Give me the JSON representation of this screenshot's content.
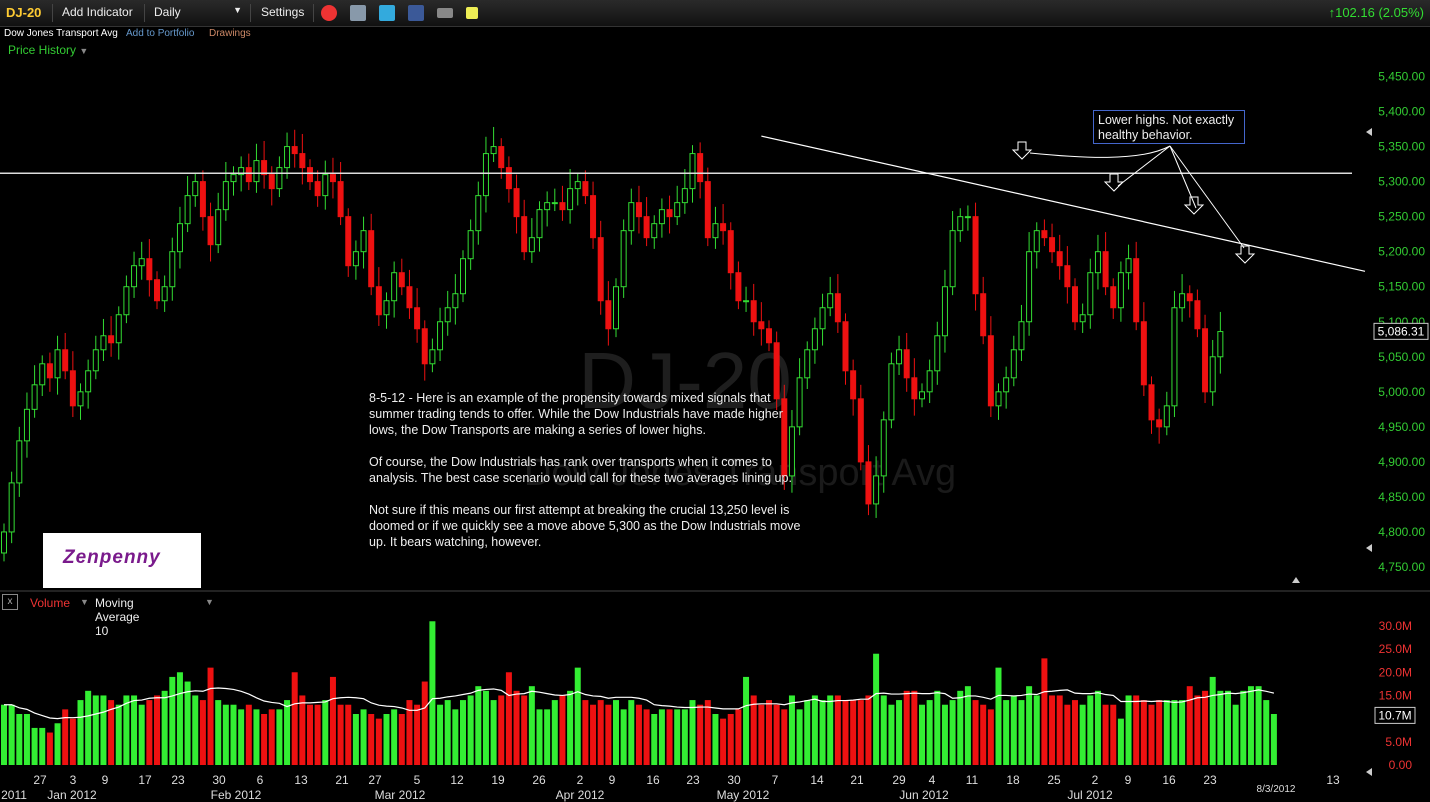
{
  "toolbar": {
    "symbol": "DJ-20",
    "add_indicator": "Add Indicator",
    "interval": "Daily",
    "settings": "Settings",
    "change": "102.16 (2.05%)",
    "change_color": "#33dd33"
  },
  "subbar": {
    "name": "Dow Jones Transport Avg",
    "add_to_portfolio": "Add to Portfolio",
    "drawings": "Drawings"
  },
  "price_history_label": "Price History",
  "watermark": {
    "symbol": "DJ-20",
    "name": "Dow Jones Transport Avg"
  },
  "note": {
    "p1": "8-5-12 - Here is an example of the propensity towards mixed signals that summer trading tends to offer. While the Dow Industrials have made higher lows, the Dow Transports are making a series of lower highs.",
    "p2": "Of course, the Dow Industrials has rank over transports when it comes to analysis. The best case scenario would call for these two averages lining up.",
    "p3": "Not sure if this means our first attempt at breaking the crucial 13,250 level is doomed or if we quickly see a move above 5,300 as the Dow Industrials move up. It bears watching, however."
  },
  "callout": "Lower highs. Not exactly healthy behavior.",
  "logo_text": "Zenpenny",
  "volume_panel": {
    "close_glyph": "x",
    "label": "Volume",
    "ma_label": "Moving Average 10",
    "current": "10.7M"
  },
  "x_axis_date_label": "8/3/2012",
  "chart_data": [
    {
      "type": "candlestick",
      "title": "",
      "y_ticks": [
        "4,750.00",
        "4,800.00",
        "4,850.00",
        "4,900.00",
        "4,950.00",
        "5,000.00",
        "5,050.00",
        "5,100.00",
        "5,150.00",
        "5,200.00",
        "5,250.00",
        "5,300.00",
        "5,350.00",
        "5,400.00",
        "5,450.00"
      ],
      "ylim": [
        4720,
        5485
      ],
      "last_price": "5,086.31",
      "horizontal_line": 5312,
      "trendline": [
        [
          5365,
          5172
        ]
      ],
      "x_day_labels": [
        "27",
        "3",
        "9",
        "17",
        "23",
        "30",
        "6",
        "13",
        "21",
        "27",
        "5",
        "12",
        "19",
        "26",
        "2",
        "9",
        "16",
        "23",
        "30",
        "7",
        "14",
        "21",
        "29",
        "4",
        "11",
        "18",
        "25",
        "2",
        "9",
        "16",
        "23",
        "13"
      ],
      "x_month_labels": [
        "2011",
        "Jan 2012",
        "Feb 2012",
        "Mar 2012",
        "Apr 2012",
        "May 2012",
        "Jun 2012",
        "Jul 2012"
      ],
      "closes": [
        4800,
        4870,
        4930,
        4975,
        5010,
        5040,
        5020,
        5060,
        5030,
        4980,
        5000,
        5030,
        5060,
        5080,
        5070,
        5110,
        5150,
        5180,
        5190,
        5160,
        5130,
        5150,
        5200,
        5240,
        5280,
        5300,
        5250,
        5210,
        5260,
        5300,
        5310,
        5320,
        5300,
        5330,
        5310,
        5290,
        5320,
        5350,
        5340,
        5320,
        5300,
        5280,
        5310,
        5300,
        5250,
        5180,
        5200,
        5230,
        5150,
        5110,
        5130,
        5170,
        5150,
        5120,
        5090,
        5040,
        5060,
        5100,
        5120,
        5140,
        5190,
        5230,
        5280,
        5340,
        5350,
        5320,
        5290,
        5250,
        5200,
        5220,
        5260,
        5270,
        5270,
        5260,
        5290,
        5300,
        5280,
        5220,
        5130,
        5090,
        5150,
        5230,
        5270,
        5250,
        5220,
        5240,
        5260,
        5250,
        5270,
        5290,
        5340,
        5300,
        5220,
        5240,
        5230,
        5170,
        5130,
        5130,
        5100,
        5090,
        5070,
        4990,
        4880,
        4950,
        5020,
        5060,
        5090,
        5120,
        5140,
        5100,
        5030,
        4990,
        4900,
        4840,
        4880,
        4960,
        5040,
        5060,
        5020,
        4990,
        5000,
        5030,
        5080,
        5150,
        5230,
        5250,
        5250,
        5140,
        5080,
        4980,
        5000,
        5020,
        5060,
        5100,
        5200,
        5230,
        5220,
        5200,
        5180,
        5150,
        5100,
        5110,
        5170,
        5200,
        5150,
        5120,
        5170,
        5190,
        5100,
        5010,
        4960,
        4950,
        4980,
        5120,
        5140,
        5130,
        5090,
        5000,
        5050,
        5086
      ],
      "volume": {
        "y_ticks": [
          "0.00",
          "5.0M",
          "10.0M",
          "15.0M",
          "20.0M",
          "25.0M",
          "30.0M"
        ],
        "ylim": [
          0,
          33
        ],
        "values": [
          13,
          13,
          11,
          11,
          8,
          8,
          7,
          9,
          12,
          10,
          14,
          16,
          15,
          15,
          14,
          13,
          15,
          15,
          13,
          14,
          15,
          16,
          19,
          20,
          18,
          15,
          14,
          21,
          14,
          13,
          13,
          12,
          13,
          12,
          11,
          12,
          12,
          14,
          20,
          15,
          13,
          13,
          14,
          19,
          13,
          13,
          11,
          12,
          11,
          10,
          11,
          12,
          11,
          14,
          13,
          18,
          31,
          13,
          14,
          12,
          14,
          15,
          17,
          16,
          14,
          15,
          20,
          16,
          15,
          17,
          12,
          12,
          14,
          15,
          16,
          21,
          14,
          13,
          14,
          13,
          14,
          12,
          14,
          13,
          12,
          11,
          12,
          12,
          12,
          12,
          14,
          13,
          14,
          11,
          10,
          11,
          12,
          19,
          15,
          13,
          14,
          13,
          12,
          15,
          12,
          14,
          15,
          14,
          15,
          15,
          14,
          14,
          14,
          15,
          24,
          15,
          13,
          14,
          16,
          16,
          13,
          14,
          16,
          13,
          14,
          16,
          17,
          14,
          13,
          12,
          21,
          14,
          15,
          14,
          17,
          15,
          23,
          15,
          15,
          13,
          14,
          13,
          15,
          16,
          13,
          13,
          10,
          15,
          15,
          14,
          13,
          14,
          14,
          14,
          14,
          17,
          15,
          16,
          19,
          16,
          16,
          13,
          16,
          17,
          17,
          14,
          11
        ]
      }
    }
  ]
}
